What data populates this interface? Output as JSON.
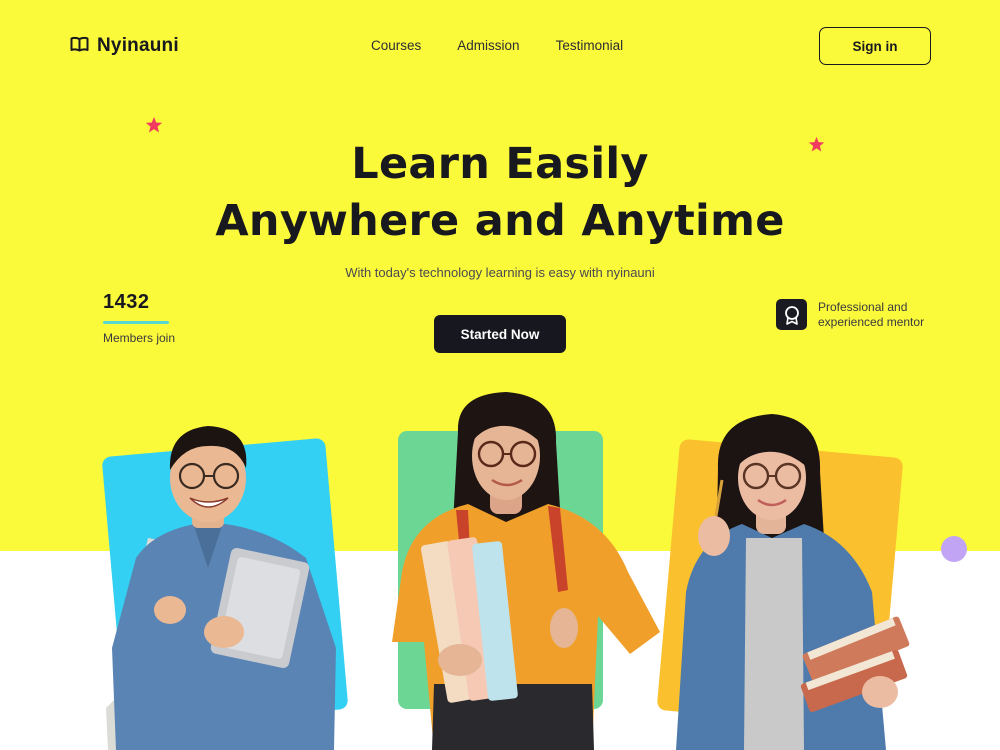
{
  "brand": {
    "name": "Nyinauni",
    "icon": "open-book-icon"
  },
  "nav": {
    "links": [
      "Courses",
      "Admission",
      "Testimonial"
    ],
    "signin_label": "Sign in"
  },
  "hero": {
    "title_line1": "Learn Easily",
    "title_line2": "Anywhere and Anytime",
    "subtitle": "With today's technology learning is easy with nyinauni",
    "cta_label": "Started Now"
  },
  "stats": {
    "members_count": "1432",
    "members_label": "Members join"
  },
  "mentor": {
    "icon": "award-badge-icon",
    "text_line1": "Professional and",
    "text_line2": "experienced mentor"
  },
  "colors": {
    "hero_bg": "#faf93a",
    "accent_dark": "#17171f",
    "star": "#f03a5f",
    "card_blue": "#33d0f3",
    "card_green": "#6cd695",
    "card_orange": "#fbc02d",
    "dot": "#c2a4f5",
    "underline": "#56d8ce"
  },
  "images": [
    {
      "name": "student-man-laptop-photo"
    },
    {
      "name": "student-woman-binders-photo"
    },
    {
      "name": "student-woman-books-photo"
    }
  ]
}
